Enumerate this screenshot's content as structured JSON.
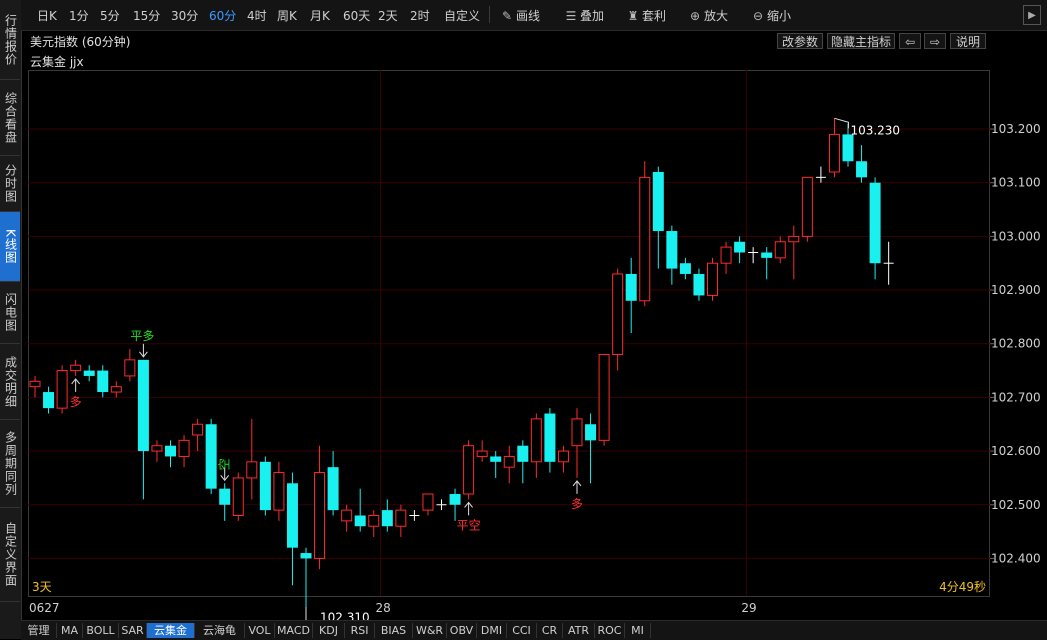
{
  "left_tabs": [
    {
      "label": "行情报价",
      "active": false
    },
    {
      "label": "综合看盘",
      "active": false
    },
    {
      "label": "分时图",
      "active": false
    },
    {
      "label": "K线图",
      "active": true
    },
    {
      "label": "闪电图",
      "active": false
    },
    {
      "label": "成交明细",
      "active": false
    },
    {
      "label": "多周期同列",
      "active": false
    },
    {
      "label": "自定义界面",
      "active": false
    }
  ],
  "toolbar": {
    "periods": [
      "日K",
      "1分",
      "5分",
      "15分",
      "30分",
      "60分",
      "4时",
      "周K",
      "月K",
      "60天",
      "2天",
      "2时",
      "自定义"
    ],
    "selected_period": "60分",
    "draw_label": "画线",
    "overlay_label": "叠加",
    "template_label": "套利",
    "zoom_in_label": "放大",
    "zoom_out_label": "缩小"
  },
  "header": {
    "title": "美元指数 (60分钟)",
    "buttons": {
      "params": "改参数",
      "hide_indicator": "隐藏主指标",
      "prev": "⇦",
      "next": "⇨",
      "help": "说明"
    }
  },
  "indicator_label": "云集金 jjx",
  "chart_info": {
    "range_label": "3天",
    "countdown": "4分49秒"
  },
  "colors": {
    "up": "#ff2a2a",
    "down": "#19f0f0",
    "accent": "#1f6fd1",
    "grid": "#3a0000"
  },
  "status_tabs": [
    "管理",
    "MA",
    "BOLL",
    "SAR",
    "云集金",
    "云海龟",
    "VOL",
    "MACD",
    "KDJ",
    "RSI",
    "BIAS",
    "W&R",
    "OBV",
    "DMI",
    "CCI",
    "CR",
    "ATR",
    "ROC",
    "MI"
  ],
  "status_active": "云集金",
  "chart_data": {
    "type": "candlestick",
    "ylim": [
      102.33,
      103.31
    ],
    "y_ticks": [
      "103.200",
      "103.100",
      "103.000",
      "102.900",
      "102.800",
      "102.700",
      "102.600",
      "102.500",
      "102.400"
    ],
    "x_tick_labels": [
      {
        "label": "0627",
        "index": 0
      },
      {
        "label": "28",
        "index": 26
      },
      {
        "label": "29",
        "index": 53
      }
    ],
    "candles": [
      [
        102.72,
        102.73,
        102.7,
        102.74
      ],
      [
        102.71,
        102.68,
        102.67,
        102.72
      ],
      [
        102.68,
        102.75,
        102.67,
        102.76
      ],
      [
        102.75,
        102.76,
        102.74,
        102.77
      ],
      [
        102.75,
        102.74,
        102.73,
        102.76
      ],
      [
        102.75,
        102.71,
        102.7,
        102.76
      ],
      [
        102.71,
        102.72,
        102.7,
        102.73
      ],
      [
        102.74,
        102.77,
        102.73,
        102.79
      ],
      [
        102.77,
        102.6,
        102.51,
        102.77
      ],
      [
        102.6,
        102.61,
        102.58,
        102.62
      ],
      [
        102.61,
        102.59,
        102.57,
        102.62
      ],
      [
        102.59,
        102.62,
        102.57,
        102.63
      ],
      [
        102.63,
        102.65,
        102.6,
        102.66
      ],
      [
        102.65,
        102.53,
        102.52,
        102.66
      ],
      [
        102.53,
        102.5,
        102.47,
        102.54
      ],
      [
        102.48,
        102.55,
        102.47,
        102.56
      ],
      [
        102.55,
        102.58,
        102.51,
        102.66
      ],
      [
        102.58,
        102.49,
        102.48,
        102.59
      ],
      [
        102.49,
        102.56,
        102.47,
        102.58
      ],
      [
        102.54,
        102.42,
        102.35,
        102.56
      ],
      [
        102.41,
        102.4,
        102.31,
        102.42
      ],
      [
        102.4,
        102.56,
        102.38,
        102.61
      ],
      [
        102.57,
        102.49,
        102.48,
        102.6
      ],
      [
        102.47,
        102.49,
        102.45,
        102.5
      ],
      [
        102.48,
        102.46,
        102.45,
        102.53
      ],
      [
        102.46,
        102.48,
        102.44,
        102.49
      ],
      [
        102.49,
        102.46,
        102.45,
        102.51
      ],
      [
        102.46,
        102.49,
        102.44,
        102.5
      ],
      [
        102.48,
        102.48,
        102.47,
        102.49
      ],
      [
        102.49,
        102.52,
        102.48,
        102.52
      ],
      [
        102.5,
        102.5,
        102.49,
        102.51
      ],
      [
        102.52,
        102.5,
        102.47,
        102.53
      ],
      [
        102.52,
        102.61,
        102.51,
        102.62
      ],
      [
        102.59,
        102.6,
        102.58,
        102.62
      ],
      [
        102.59,
        102.58,
        102.55,
        102.6
      ],
      [
        102.57,
        102.59,
        102.54,
        102.61
      ],
      [
        102.61,
        102.58,
        102.54,
        102.62
      ],
      [
        102.58,
        102.66,
        102.55,
        102.67
      ],
      [
        102.67,
        102.58,
        102.56,
        102.68
      ],
      [
        102.58,
        102.6,
        102.56,
        102.61
      ],
      [
        102.61,
        102.66,
        102.55,
        102.68
      ],
      [
        102.65,
        102.62,
        102.54,
        102.67
      ],
      [
        102.62,
        102.78,
        102.61,
        102.78
      ],
      [
        102.78,
        102.93,
        102.75,
        102.94
      ],
      [
        102.93,
        102.88,
        102.82,
        102.96
      ],
      [
        102.88,
        103.11,
        102.87,
        103.14
      ],
      [
        103.12,
        103.01,
        102.94,
        103.13
      ],
      [
        103.01,
        102.94,
        102.91,
        103.02
      ],
      [
        102.95,
        102.93,
        102.92,
        102.96
      ],
      [
        102.93,
        102.89,
        102.88,
        102.94
      ],
      [
        102.89,
        102.95,
        102.88,
        102.96
      ],
      [
        102.95,
        102.98,
        102.93,
        102.99
      ],
      [
        102.99,
        102.97,
        102.95,
        103.0
      ],
      [
        102.97,
        102.97,
        102.95,
        102.98
      ],
      [
        102.97,
        102.96,
        102.92,
        102.98
      ],
      [
        102.96,
        102.99,
        102.95,
        103.0
      ],
      [
        102.99,
        103.0,
        102.92,
        103.02
      ],
      [
        103.0,
        103.11,
        102.99,
        103.11
      ],
      [
        103.11,
        103.11,
        103.1,
        103.13
      ],
      [
        103.12,
        103.19,
        103.11,
        103.22
      ],
      [
        103.19,
        103.14,
        103.13,
        103.21
      ],
      [
        103.14,
        103.11,
        103.1,
        103.17
      ],
      [
        103.1,
        102.95,
        102.92,
        103.11
      ],
      [
        102.95,
        102.95,
        102.91,
        102.99
      ]
    ],
    "annotations": [
      {
        "text": "平多",
        "index": 8,
        "color": "#22e022",
        "arrow": "down",
        "pos": "above"
      },
      {
        "text": "空",
        "index": 14,
        "color": "#22e022",
        "arrow": "down",
        "pos": "above"
      },
      {
        "text": "多",
        "index": 3,
        "color": "#ff3030",
        "arrow": "up",
        "pos": "below"
      },
      {
        "text": "平空",
        "index": 32,
        "color": "#ff3030",
        "arrow": "up",
        "pos": "below"
      },
      {
        "text": "多",
        "index": 40,
        "color": "#ff3030",
        "arrow": "up",
        "pos": "below"
      }
    ],
    "extremes": [
      {
        "label": "103.230",
        "index": 59,
        "type": "high"
      },
      {
        "label": "102.310",
        "index": 20,
        "type": "low"
      }
    ]
  }
}
